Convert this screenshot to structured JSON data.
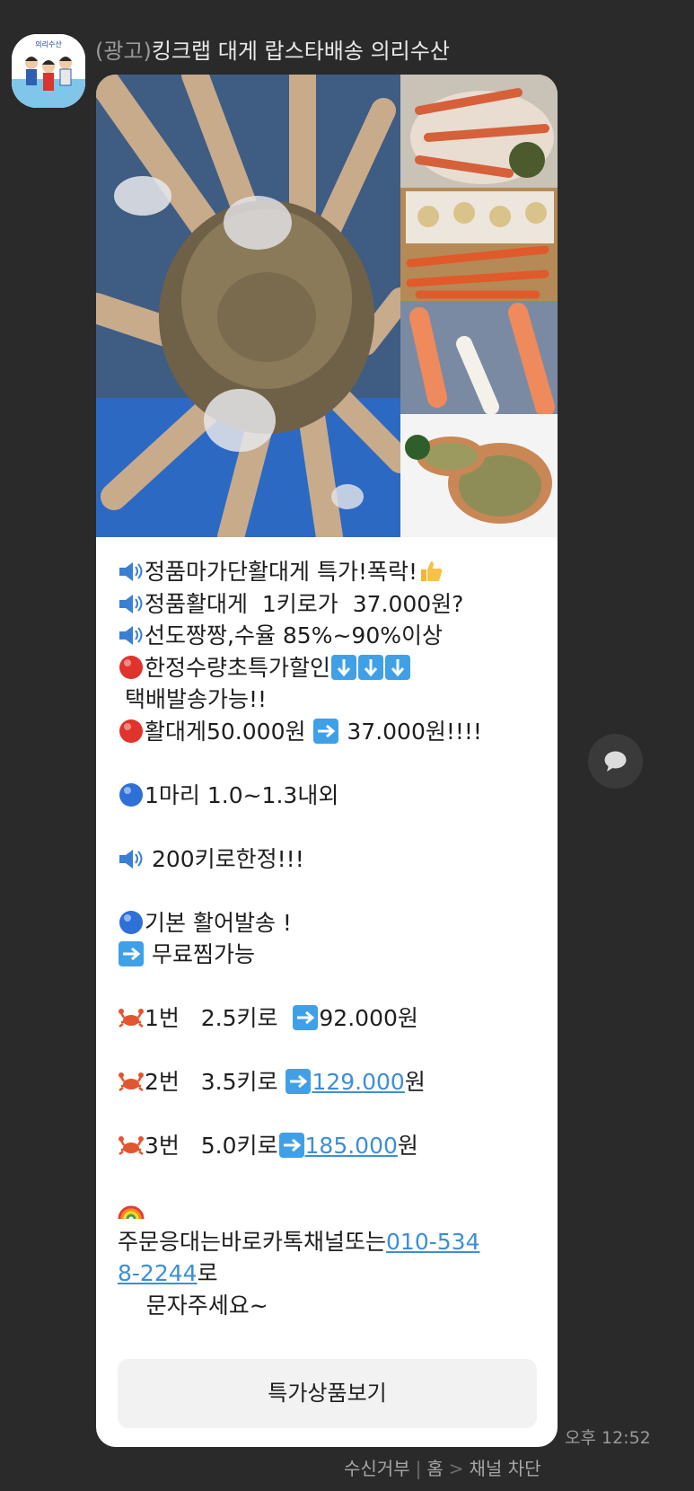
{
  "sender": {
    "ad_tag": "(광고)",
    "name": "킹크랩 대게 랍스타배송 의리수산",
    "avatar_text": "의리수산"
  },
  "message": {
    "lines": [
      {
        "icon": "speaker-icon",
        "text": "정품마가단활대게 특가!폭락!",
        "suffix_icon": "thumbs-up-icon"
      },
      {
        "icon": "speaker-icon",
        "text": "정품활대게  1키로가  37.000원?"
      },
      {
        "icon": "speaker-icon",
        "text": "선도짱짱,수율 85%~90%이상"
      },
      {
        "icon": "red-circle-icon",
        "text": "한정수량초특가할인",
        "suffix_icon": "down-arrow-icons"
      },
      {
        "text": " 택배발송가능!!"
      },
      {
        "icon": "red-circle-icon",
        "text": "활대게50.000원 ",
        "mid_icon": "right-arrow-icon",
        "text2": " 37.000원!!!!"
      },
      {
        "icon": "blue-circle-icon",
        "text": "1마리 1.0~1.3내외"
      },
      {
        "icon": "speaker-icon",
        "text": " 200키로한정!!!"
      },
      {
        "icon": "blue-circle-icon",
        "text": "기본 활어발송 !"
      },
      {
        "icon": "right-arrow-icon",
        "text": " 무료찜가능"
      },
      {
        "icon": "crab-icon",
        "text": "1번   2.5키로  ",
        "arrow_icon": "right-arrow-icon",
        "text2": "92.000원"
      },
      {
        "icon": "crab-icon",
        "text": "2번   3.5키로 ",
        "arrow_icon": "right-arrow-icon",
        "link": "129.000",
        "text2": "원"
      },
      {
        "icon": "crab-icon",
        "text": "3번   5.0키로",
        "arrow_icon": "right-arrow-icon",
        "link": "185.000",
        "text2": "원"
      },
      {
        "icon": "rainbow-icon"
      },
      {
        "text": "주문응대는바로카톡채널또는",
        "link": "010-534"
      },
      {
        "link": "8-2244",
        "text2": "로"
      },
      {
        "text": "    문자주세요~"
      }
    ],
    "cta_label": "특가상품보기",
    "time": "오후 12:52"
  },
  "footer": {
    "reject": "수신거부",
    "sep": "|",
    "home": "홈",
    "chevron": ">",
    "block": "채널 차단"
  },
  "colors": {
    "background": "#2a2a2a",
    "bubble": "#ffffff",
    "link": "#3d8ed8"
  }
}
